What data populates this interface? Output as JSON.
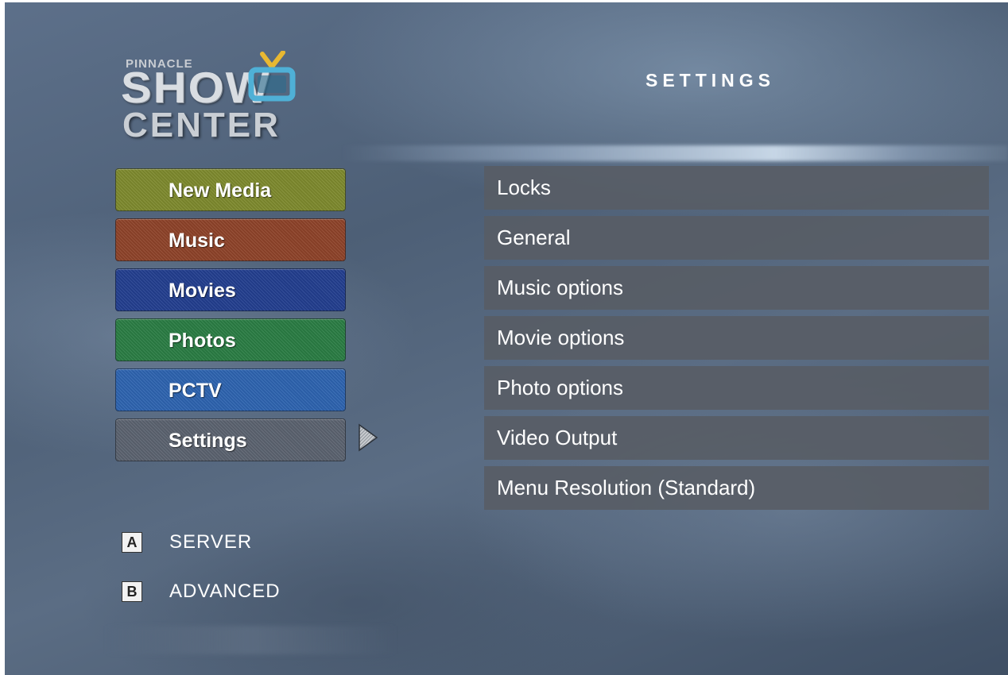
{
  "logo": {
    "line1": "PINNACLE",
    "line2": "SHOW",
    "line3": "CENTER",
    "tv_icon": "tv-icon",
    "accent_color": "#e8b832"
  },
  "header": {
    "title": "SETTINGS"
  },
  "menu": {
    "items": [
      {
        "label": "New Media",
        "color": "#7e8a2e"
      },
      {
        "label": "Music",
        "color": "#8e4329"
      },
      {
        "label": "Movies",
        "color": "#233f8f"
      },
      {
        "label": "Photos",
        "color": "#2a7d44"
      },
      {
        "label": "PCTV",
        "color": "#2e64b0"
      },
      {
        "label": "Settings",
        "color": "#5b6370",
        "selected": true
      }
    ],
    "selected_indicator_icon": "chevron-right-icon"
  },
  "options": {
    "items": [
      {
        "label": "Locks"
      },
      {
        "label": "General"
      },
      {
        "label": "Music options"
      },
      {
        "label": "Movie options"
      },
      {
        "label": "Photo options"
      },
      {
        "label": "Video Output"
      },
      {
        "label": "Menu Resolution (Standard)"
      }
    ]
  },
  "shortcuts": [
    {
      "key": "A",
      "label": "SERVER"
    },
    {
      "key": "B",
      "label": "ADVANCED"
    }
  ]
}
